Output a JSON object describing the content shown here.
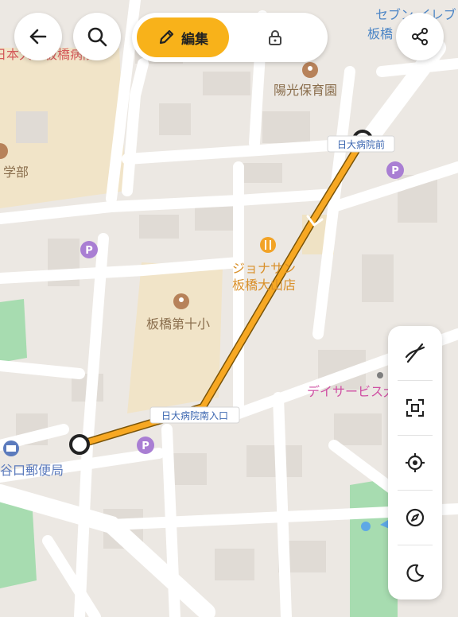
{
  "labels": {
    "top_partial_right": "セブン-イレブン",
    "top_partial_right2": "板橋",
    "hospital_partial": "日本大学板橋病院",
    "nursery": "陽光保育園",
    "faculty_partial": "学部",
    "restaurant_line1": "ジョナサン",
    "restaurant_line2": "板橋大山店",
    "school": "板橋第十小",
    "dayservice": "デイサービス大山",
    "post_office": "谷口郵便局",
    "bus_stop_start": "日大病院前",
    "bus_stop_end": "日大病院南入口"
  },
  "toolbar": {
    "edit_label": "編集"
  },
  "colors": {
    "route": "#f7a823",
    "accent": "#f8b21a",
    "poi": "#a97ed3",
    "park": "#a7dcb0"
  },
  "icons": {
    "back": "arrow-left-icon",
    "search": "search-icon",
    "edit": "pencil-icon",
    "lock": "lock-icon",
    "share": "share-icon",
    "layers": "no-route-icon",
    "fit": "fit-bounds-icon",
    "locate": "crosshair-icon",
    "compass": "compass-icon",
    "night": "moon-icon"
  }
}
